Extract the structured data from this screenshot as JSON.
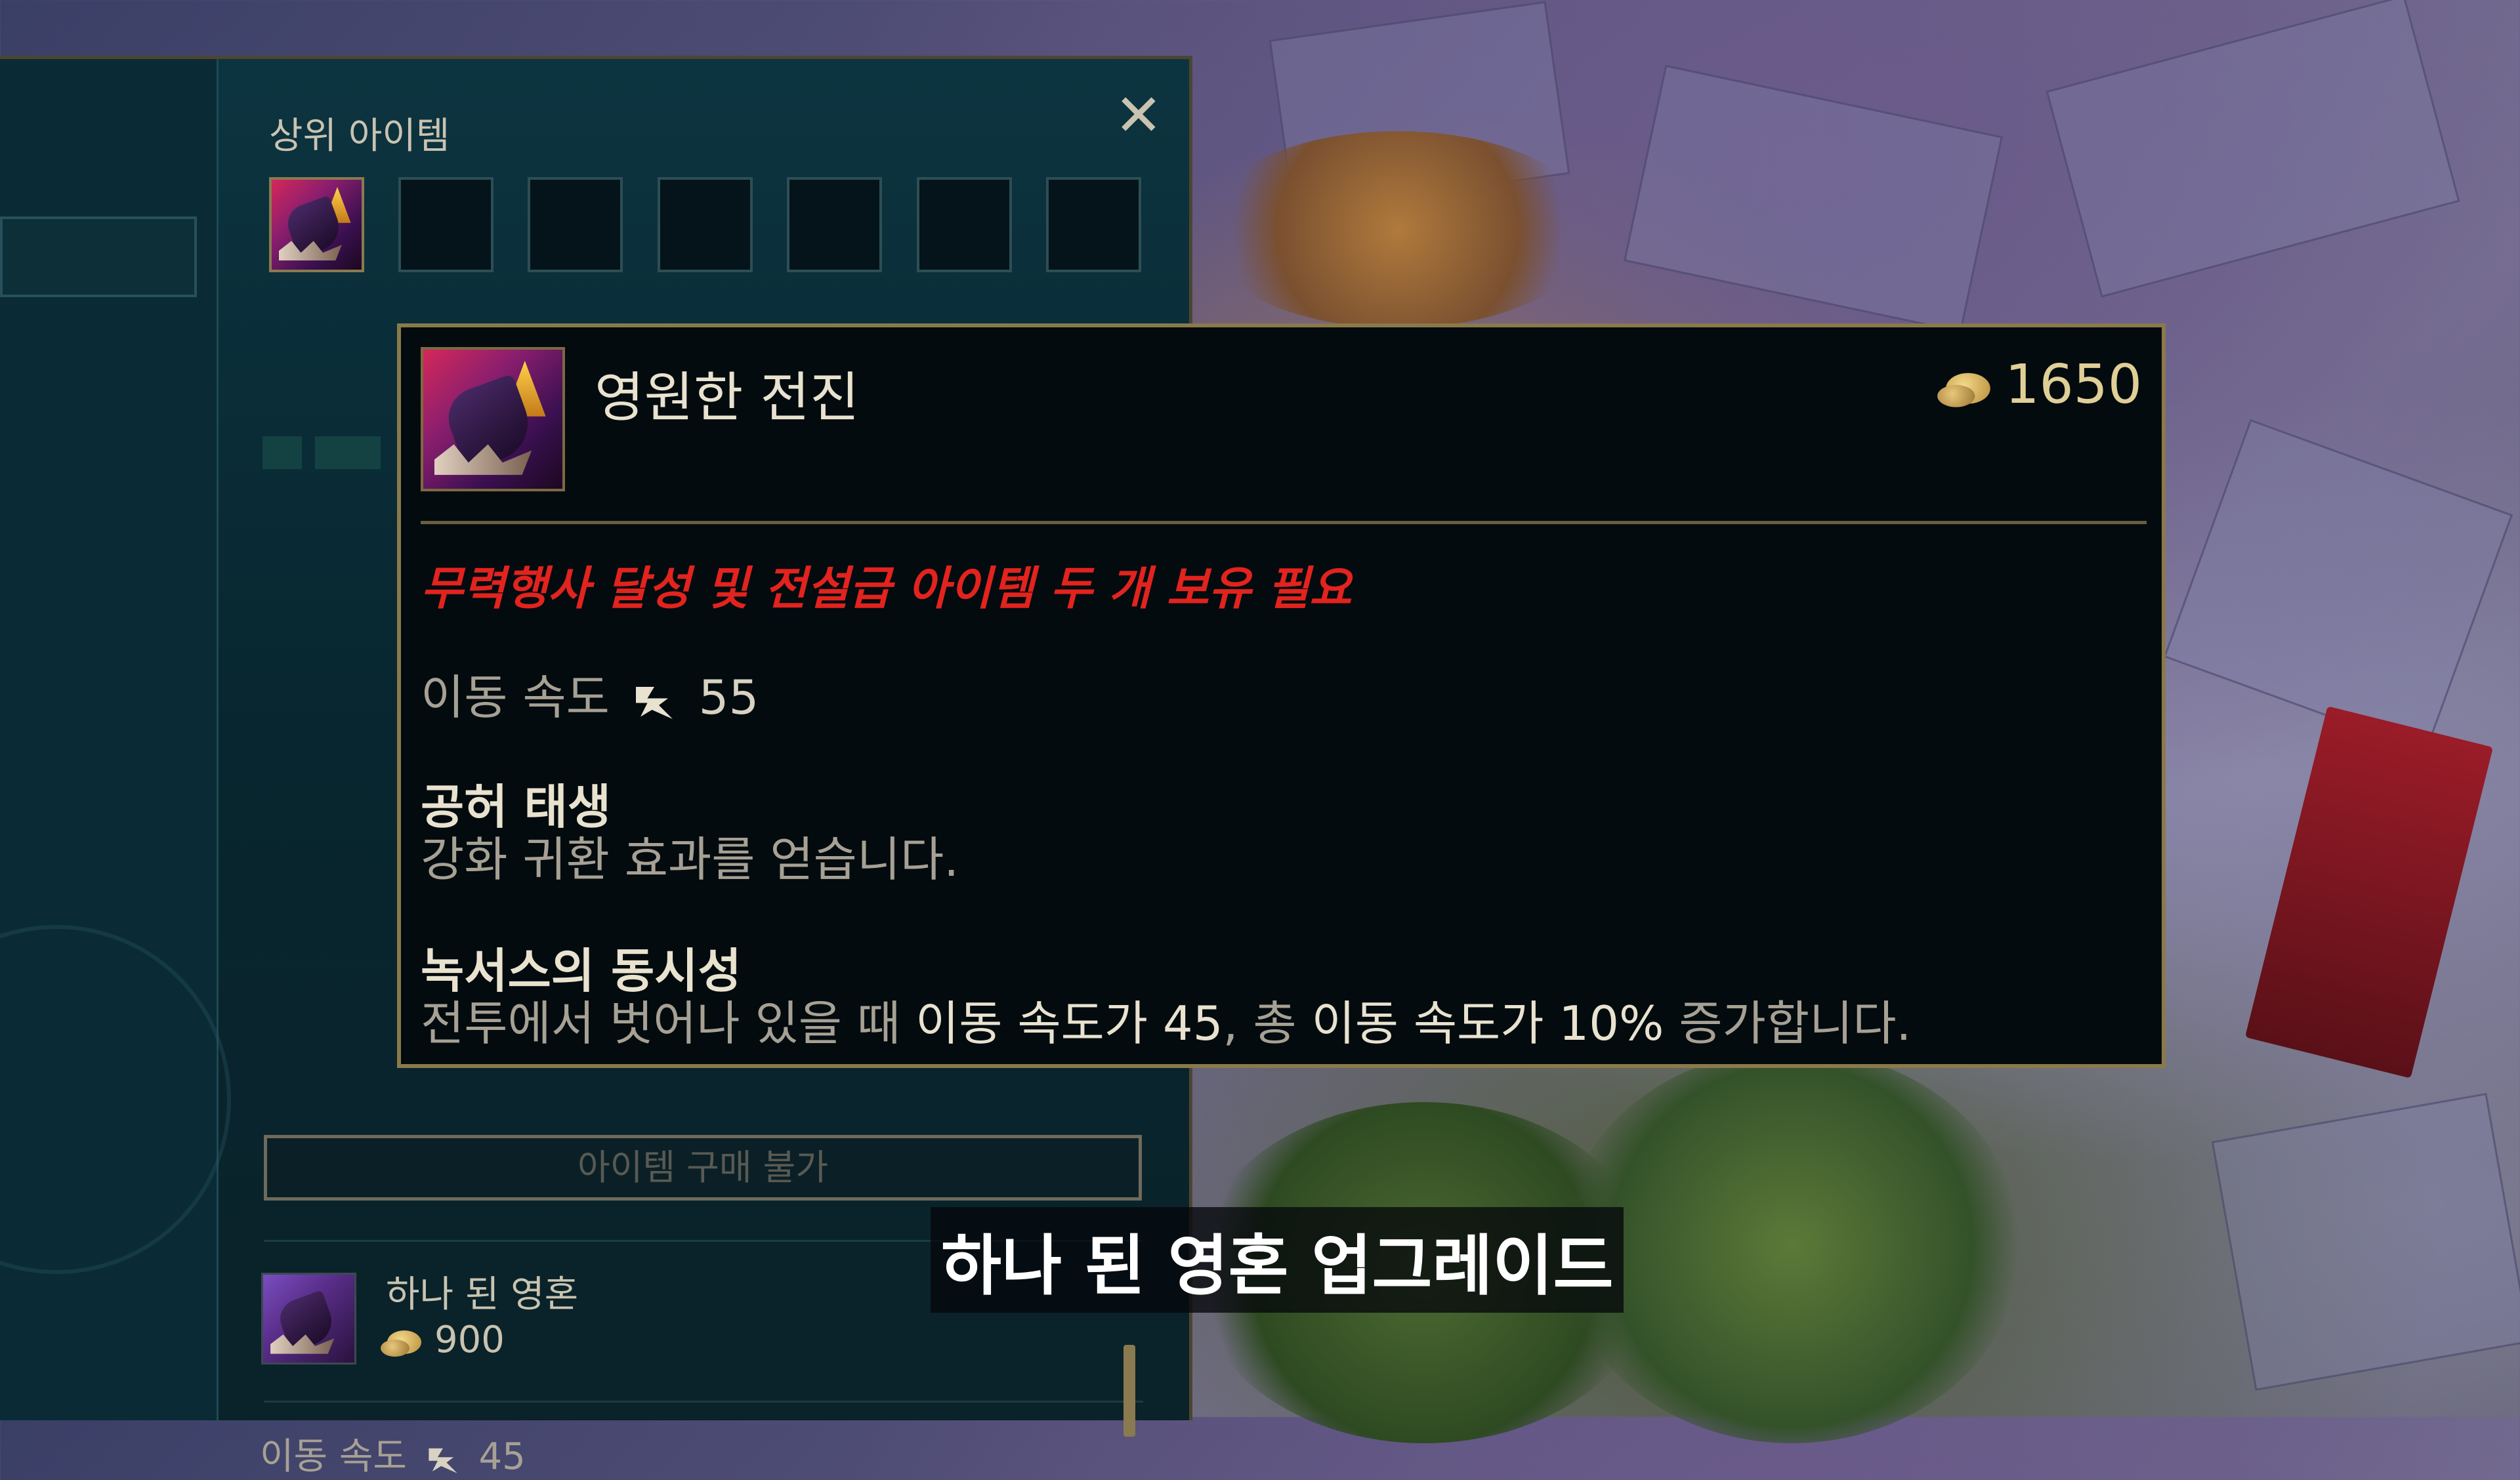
{
  "shop": {
    "section_title": "상위 아이템",
    "close_label": "✕",
    "upgrade_slots": [
      {
        "filled": true,
        "item": "영원한 전진"
      },
      {
        "filled": false
      },
      {
        "filled": false
      },
      {
        "filled": false
      },
      {
        "filled": false
      },
      {
        "filled": false
      },
      {
        "filled": false
      }
    ],
    "buy_button_label": "아이템 구매 불가",
    "component": {
      "name": "하나 된 영혼",
      "price": "900",
      "stat_label": "이동 속도",
      "stat_value": "45"
    }
  },
  "tooltip": {
    "item_name": "영원한 전진",
    "price": "1650",
    "requirement": "무력행사 달성 및 전설급 아이템 두 개 보유 필요",
    "stat_label": "이동 속도",
    "stat_value": "55",
    "passive1_title": "공허 태생",
    "passive1_desc": "강화 귀환 효과를 얻습니다.",
    "passive2_title": "녹서스의 동시성",
    "passive2_desc_a": "전투에서 벗어나 있을 때 ",
    "passive2_desc_b": "이동 속도가 45",
    "passive2_desc_c": ", 총 ",
    "passive2_desc_d": "이동 속도가 10%",
    "passive2_desc_e": " 증가합니다."
  },
  "subtitle": "하나 된 영혼 업그레이드",
  "colors": {
    "requirement_red": "#e2231e",
    "gold": "#e0cf96",
    "panel_teal": "#0c3440"
  },
  "icons": [
    "close-icon",
    "gold-coin-icon",
    "movement-speed-icon"
  ]
}
